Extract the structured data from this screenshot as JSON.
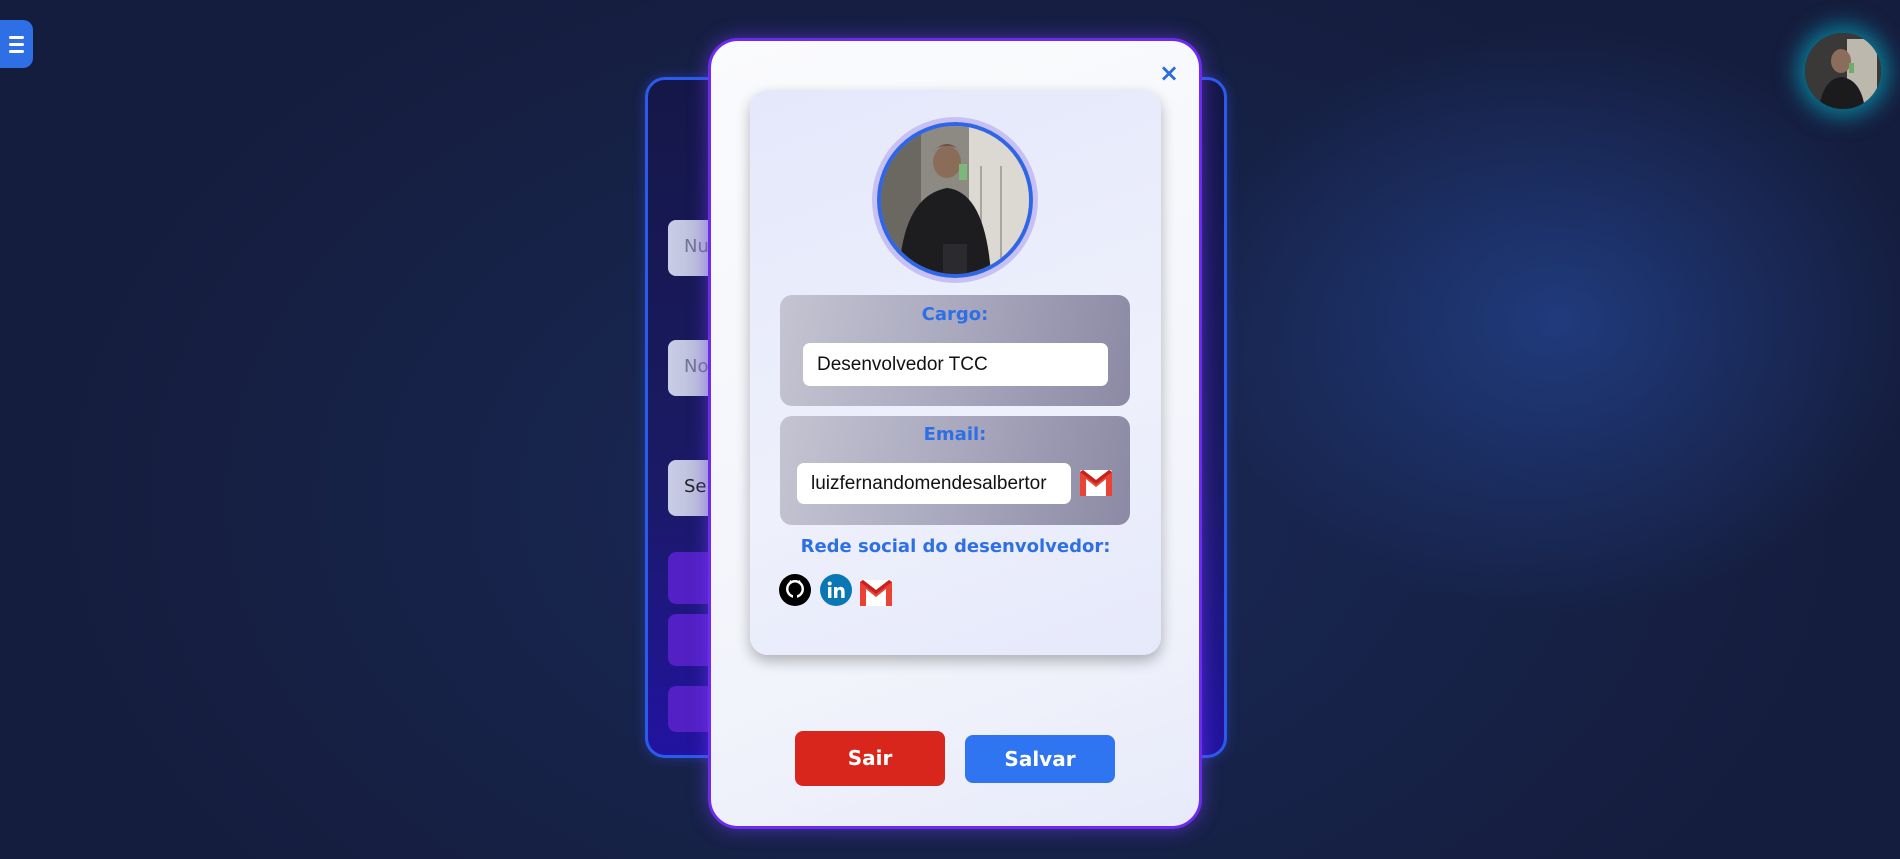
{
  "menu": {
    "icon": "hamburger-icon"
  },
  "user_avatar": {
    "icon": "user-avatar"
  },
  "background_form": {
    "fields": [
      "Nu",
      "No",
      "Se"
    ]
  },
  "modal": {
    "close_symbol": "×",
    "cargo": {
      "label": "Cargo:",
      "value": "Desenvolvedor TCC"
    },
    "email": {
      "label": "Email:",
      "value": "luizfernandomendesalbertor",
      "icon": "gmail-icon"
    },
    "social": {
      "title": "Rede social do desenvolvedor:",
      "icons": [
        "github-icon",
        "linkedin-icon",
        "gmail-icon"
      ]
    },
    "buttons": {
      "exit": "Sair",
      "save": "Salvar"
    }
  },
  "colors": {
    "accent_blue": "#2f6fe6",
    "exit_red": "#d9261c",
    "save_blue": "#2f74f0",
    "modal_border": "#6d2bf0"
  }
}
